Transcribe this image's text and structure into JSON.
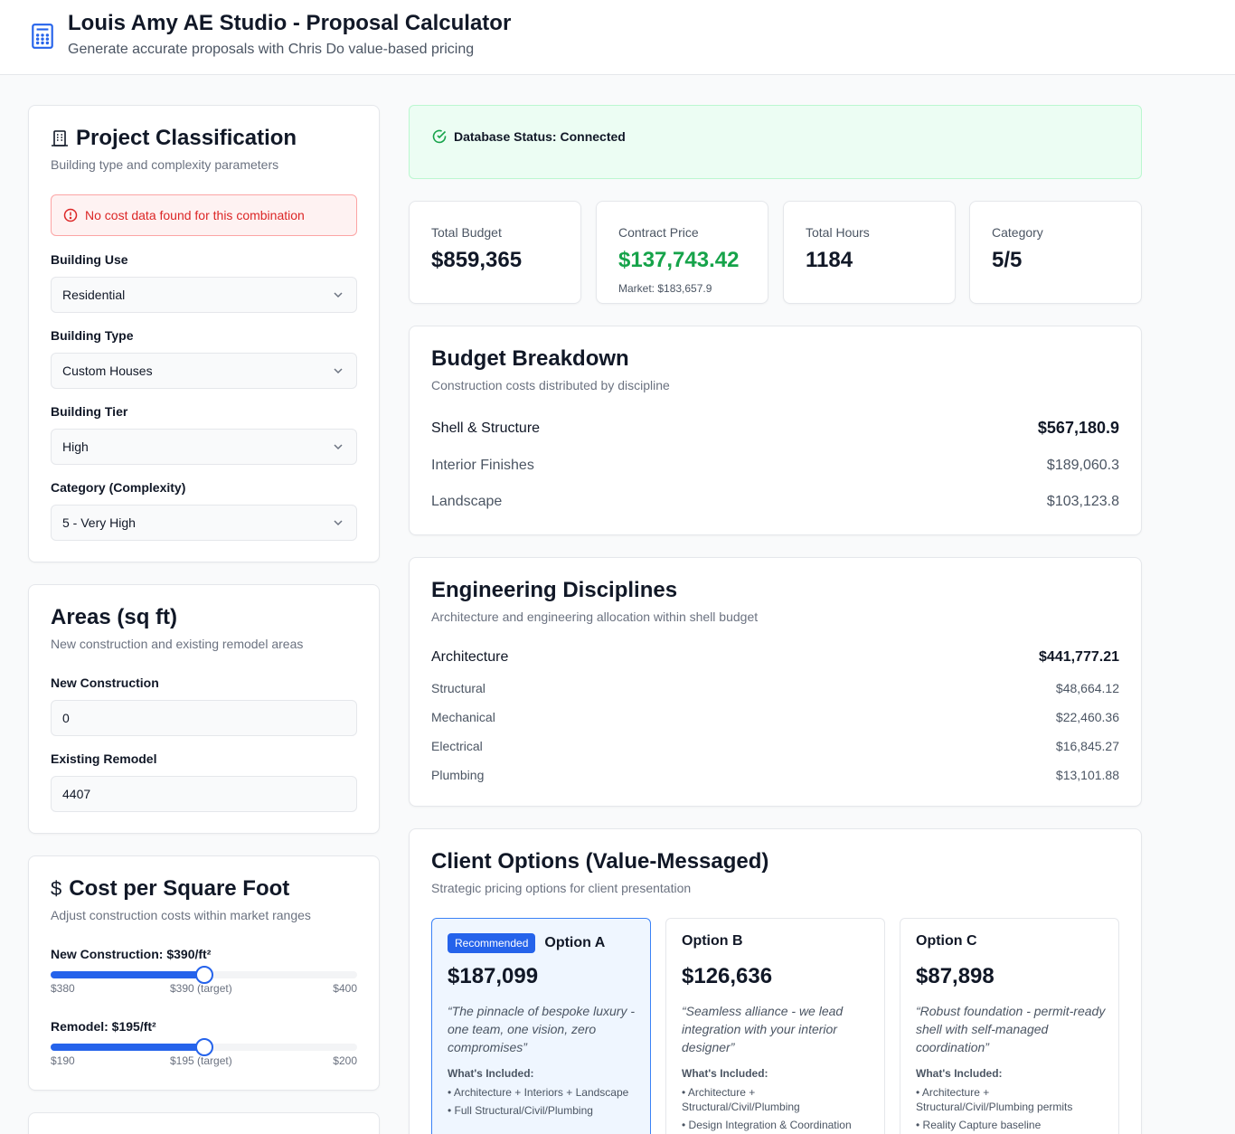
{
  "header": {
    "title": "Louis Amy AE Studio - Proposal Calculator",
    "subtitle": "Generate accurate proposals with Chris Do value-based pricing",
    "icon": "calculator-icon"
  },
  "classification": {
    "title": "Project Classification",
    "subtitle": "Building type and complexity parameters",
    "alert": "No cost data found for this combination",
    "building_use": {
      "label": "Building Use",
      "value": "Residential"
    },
    "building_type": {
      "label": "Building Type",
      "value": "Custom Houses"
    },
    "building_tier": {
      "label": "Building Tier",
      "value": "High"
    },
    "category": {
      "label": "Category (Complexity)",
      "value": "5 - Very High"
    }
  },
  "areas": {
    "title": "Areas (sq ft)",
    "subtitle": "New construction and existing remodel areas",
    "new_construction": {
      "label": "New Construction",
      "value": "0"
    },
    "existing_remodel": {
      "label": "Existing Remodel",
      "value": "4407"
    }
  },
  "cost": {
    "title": "Cost per Square Foot",
    "subtitle": "Adjust construction costs within market ranges",
    "new": {
      "label": "New Construction: $390/ft²",
      "min": "$380",
      "target": "$390 (target)",
      "max": "$400",
      "level": 0.5
    },
    "remodel": {
      "label": "Remodel: $195/ft²",
      "min": "$190",
      "target": "$195 (target)",
      "max": "$200",
      "level": 0.5
    }
  },
  "status": {
    "text": "Database Status: Connected"
  },
  "stats": {
    "total_budget": {
      "label": "Total Budget",
      "value": "$859,365"
    },
    "contract_price": {
      "label": "Contract Price",
      "value": "$137,743.42",
      "note": "Market: $183,657.9"
    },
    "total_hours": {
      "label": "Total Hours",
      "value": "1184"
    },
    "category": {
      "label": "Category",
      "value": "5/5"
    }
  },
  "budget": {
    "title": "Budget Breakdown",
    "subtitle": "Construction costs distributed by discipline",
    "rows": [
      {
        "name": "Shell & Structure",
        "value": "$567,180.9"
      },
      {
        "name": "Interior Finishes",
        "value": "$189,060.3"
      },
      {
        "name": "Landscape",
        "value": "$103,123.8"
      }
    ]
  },
  "engineering": {
    "title": "Engineering Disciplines",
    "subtitle": "Architecture and engineering allocation within shell budget",
    "rows": [
      {
        "name": "Architecture",
        "value": "$441,777.21"
      },
      {
        "name": "Structural",
        "value": "$48,664.12"
      },
      {
        "name": "Mechanical",
        "value": "$22,460.36"
      },
      {
        "name": "Electrical",
        "value": "$16,845.27"
      },
      {
        "name": "Plumbing",
        "value": "$13,101.88"
      }
    ]
  },
  "options": {
    "title": "Client Options (Value-Messaged)",
    "subtitle": "Strategic pricing options for client presentation",
    "included_label": "What's Included:",
    "items": [
      {
        "badge": "Recommended",
        "name": "Option A",
        "price": "$187,099",
        "quote": "“The pinnacle of bespoke luxury - one team, one vision, zero compromises”",
        "includes": [
          "• Architecture + Interiors + Landscape",
          "• Full Structural/Civil/Plumbing"
        ]
      },
      {
        "name": "Option B",
        "price": "$126,636",
        "quote": "“Seamless alliance - we lead integration with your interior designer”",
        "includes": [
          "• Architecture + Structural/Civil/Plumbing",
          "• Design Integration & Coordination"
        ]
      },
      {
        "name": "Option C",
        "price": "$87,898",
        "quote": "“Robust foundation - permit-ready shell with self-managed coordination”",
        "includes": [
          "• Architecture + Structural/Civil/Plumbing permits",
          "• Reality Capture baseline"
        ]
      }
    ]
  },
  "colors": {
    "accent": "#2563eb",
    "success": "#16a34a",
    "error": "#dc2626"
  }
}
